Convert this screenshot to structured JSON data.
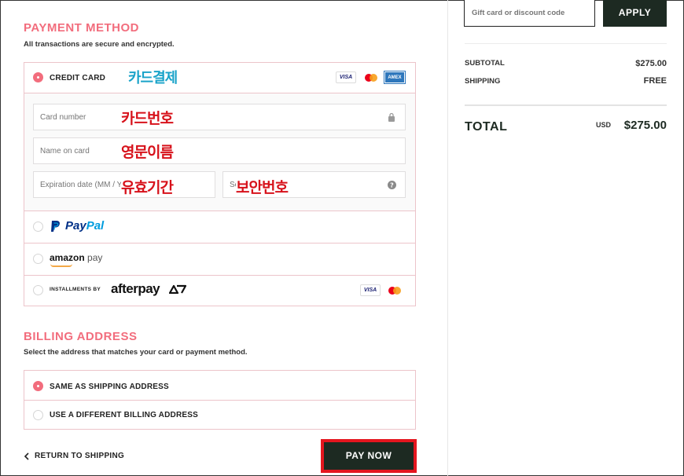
{
  "payment": {
    "title": "PAYMENT METHOD",
    "subtitle": "All transactions are secure and encrypted.",
    "credit_card": {
      "label": "CREDIT CARD",
      "annotation": "카드결제",
      "card_number_placeholder": "Card number",
      "card_number_annotation": "카드번호",
      "name_placeholder": "Name on card",
      "name_annotation": "영문이름",
      "expiration_placeholder": "Expiration date (MM / YY)",
      "expiration_annotation": "유효기간",
      "security_placeholder": "Security code",
      "security_annotation": "보안번호",
      "visa_text": "VISA",
      "amex_text": "AMEX"
    },
    "paypal": {
      "pay": "Pay",
      "pal": "Pal"
    },
    "amazon": {
      "brand": "amazon",
      "pay": "pay"
    },
    "afterpay": {
      "prefix": "INSTALLMENTS BY",
      "brand": "afterpay",
      "visa_text": "VISA"
    }
  },
  "billing": {
    "title": "BILLING ADDRESS",
    "subtitle": "Select the address that matches your card or payment method.",
    "same_label": "SAME AS SHIPPING ADDRESS",
    "different_label": "USE A DIFFERENT BILLING ADDRESS"
  },
  "footer": {
    "return_label": "RETURN TO SHIPPING",
    "pay_label": "PAY NOW"
  },
  "summary": {
    "discount_placeholder": "Gift card or discount code",
    "apply_label": "APPLY",
    "subtotal_label": "SUBTOTAL",
    "subtotal_value": "$275.00",
    "shipping_label": "SHIPPING",
    "shipping_value": "FREE",
    "total_label": "TOTAL",
    "total_currency": "USD",
    "total_value": "$275.00"
  },
  "colors": {
    "accent": "#f26d7d",
    "dark_button": "#1d2a22",
    "annotation_red": "#d7121b",
    "annotation_blue": "#1aa3c9"
  }
}
